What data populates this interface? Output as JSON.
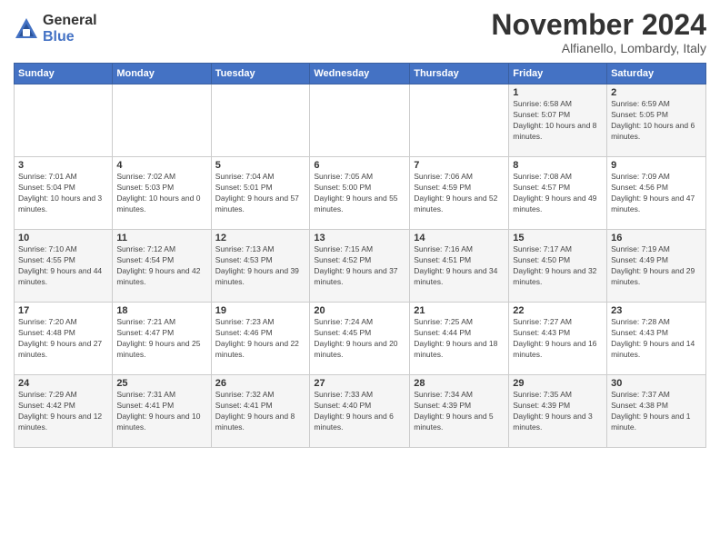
{
  "logo": {
    "general": "General",
    "blue": "Blue"
  },
  "header": {
    "month": "November 2024",
    "location": "Alfianello, Lombardy, Italy"
  },
  "weekdays": [
    "Sunday",
    "Monday",
    "Tuesday",
    "Wednesday",
    "Thursday",
    "Friday",
    "Saturday"
  ],
  "weeks": [
    [
      {
        "day": "",
        "sunrise": "",
        "sunset": "",
        "daylight": ""
      },
      {
        "day": "",
        "sunrise": "",
        "sunset": "",
        "daylight": ""
      },
      {
        "day": "",
        "sunrise": "",
        "sunset": "",
        "daylight": ""
      },
      {
        "day": "",
        "sunrise": "",
        "sunset": "",
        "daylight": ""
      },
      {
        "day": "",
        "sunrise": "",
        "sunset": "",
        "daylight": ""
      },
      {
        "day": "1",
        "sunrise": "Sunrise: 6:58 AM",
        "sunset": "Sunset: 5:07 PM",
        "daylight": "Daylight: 10 hours and 8 minutes."
      },
      {
        "day": "2",
        "sunrise": "Sunrise: 6:59 AM",
        "sunset": "Sunset: 5:05 PM",
        "daylight": "Daylight: 10 hours and 6 minutes."
      }
    ],
    [
      {
        "day": "3",
        "sunrise": "Sunrise: 7:01 AM",
        "sunset": "Sunset: 5:04 PM",
        "daylight": "Daylight: 10 hours and 3 minutes."
      },
      {
        "day": "4",
        "sunrise": "Sunrise: 7:02 AM",
        "sunset": "Sunset: 5:03 PM",
        "daylight": "Daylight: 10 hours and 0 minutes."
      },
      {
        "day": "5",
        "sunrise": "Sunrise: 7:04 AM",
        "sunset": "Sunset: 5:01 PM",
        "daylight": "Daylight: 9 hours and 57 minutes."
      },
      {
        "day": "6",
        "sunrise": "Sunrise: 7:05 AM",
        "sunset": "Sunset: 5:00 PM",
        "daylight": "Daylight: 9 hours and 55 minutes."
      },
      {
        "day": "7",
        "sunrise": "Sunrise: 7:06 AM",
        "sunset": "Sunset: 4:59 PM",
        "daylight": "Daylight: 9 hours and 52 minutes."
      },
      {
        "day": "8",
        "sunrise": "Sunrise: 7:08 AM",
        "sunset": "Sunset: 4:57 PM",
        "daylight": "Daylight: 9 hours and 49 minutes."
      },
      {
        "day": "9",
        "sunrise": "Sunrise: 7:09 AM",
        "sunset": "Sunset: 4:56 PM",
        "daylight": "Daylight: 9 hours and 47 minutes."
      }
    ],
    [
      {
        "day": "10",
        "sunrise": "Sunrise: 7:10 AM",
        "sunset": "Sunset: 4:55 PM",
        "daylight": "Daylight: 9 hours and 44 minutes."
      },
      {
        "day": "11",
        "sunrise": "Sunrise: 7:12 AM",
        "sunset": "Sunset: 4:54 PM",
        "daylight": "Daylight: 9 hours and 42 minutes."
      },
      {
        "day": "12",
        "sunrise": "Sunrise: 7:13 AM",
        "sunset": "Sunset: 4:53 PM",
        "daylight": "Daylight: 9 hours and 39 minutes."
      },
      {
        "day": "13",
        "sunrise": "Sunrise: 7:15 AM",
        "sunset": "Sunset: 4:52 PM",
        "daylight": "Daylight: 9 hours and 37 minutes."
      },
      {
        "day": "14",
        "sunrise": "Sunrise: 7:16 AM",
        "sunset": "Sunset: 4:51 PM",
        "daylight": "Daylight: 9 hours and 34 minutes."
      },
      {
        "day": "15",
        "sunrise": "Sunrise: 7:17 AM",
        "sunset": "Sunset: 4:50 PM",
        "daylight": "Daylight: 9 hours and 32 minutes."
      },
      {
        "day": "16",
        "sunrise": "Sunrise: 7:19 AM",
        "sunset": "Sunset: 4:49 PM",
        "daylight": "Daylight: 9 hours and 29 minutes."
      }
    ],
    [
      {
        "day": "17",
        "sunrise": "Sunrise: 7:20 AM",
        "sunset": "Sunset: 4:48 PM",
        "daylight": "Daylight: 9 hours and 27 minutes."
      },
      {
        "day": "18",
        "sunrise": "Sunrise: 7:21 AM",
        "sunset": "Sunset: 4:47 PM",
        "daylight": "Daylight: 9 hours and 25 minutes."
      },
      {
        "day": "19",
        "sunrise": "Sunrise: 7:23 AM",
        "sunset": "Sunset: 4:46 PM",
        "daylight": "Daylight: 9 hours and 22 minutes."
      },
      {
        "day": "20",
        "sunrise": "Sunrise: 7:24 AM",
        "sunset": "Sunset: 4:45 PM",
        "daylight": "Daylight: 9 hours and 20 minutes."
      },
      {
        "day": "21",
        "sunrise": "Sunrise: 7:25 AM",
        "sunset": "Sunset: 4:44 PM",
        "daylight": "Daylight: 9 hours and 18 minutes."
      },
      {
        "day": "22",
        "sunrise": "Sunrise: 7:27 AM",
        "sunset": "Sunset: 4:43 PM",
        "daylight": "Daylight: 9 hours and 16 minutes."
      },
      {
        "day": "23",
        "sunrise": "Sunrise: 7:28 AM",
        "sunset": "Sunset: 4:43 PM",
        "daylight": "Daylight: 9 hours and 14 minutes."
      }
    ],
    [
      {
        "day": "24",
        "sunrise": "Sunrise: 7:29 AM",
        "sunset": "Sunset: 4:42 PM",
        "daylight": "Daylight: 9 hours and 12 minutes."
      },
      {
        "day": "25",
        "sunrise": "Sunrise: 7:31 AM",
        "sunset": "Sunset: 4:41 PM",
        "daylight": "Daylight: 9 hours and 10 minutes."
      },
      {
        "day": "26",
        "sunrise": "Sunrise: 7:32 AM",
        "sunset": "Sunset: 4:41 PM",
        "daylight": "Daylight: 9 hours and 8 minutes."
      },
      {
        "day": "27",
        "sunrise": "Sunrise: 7:33 AM",
        "sunset": "Sunset: 4:40 PM",
        "daylight": "Daylight: 9 hours and 6 minutes."
      },
      {
        "day": "28",
        "sunrise": "Sunrise: 7:34 AM",
        "sunset": "Sunset: 4:39 PM",
        "daylight": "Daylight: 9 hours and 5 minutes."
      },
      {
        "day": "29",
        "sunrise": "Sunrise: 7:35 AM",
        "sunset": "Sunset: 4:39 PM",
        "daylight": "Daylight: 9 hours and 3 minutes."
      },
      {
        "day": "30",
        "sunrise": "Sunrise: 7:37 AM",
        "sunset": "Sunset: 4:38 PM",
        "daylight": "Daylight: 9 hours and 1 minute."
      }
    ]
  ]
}
